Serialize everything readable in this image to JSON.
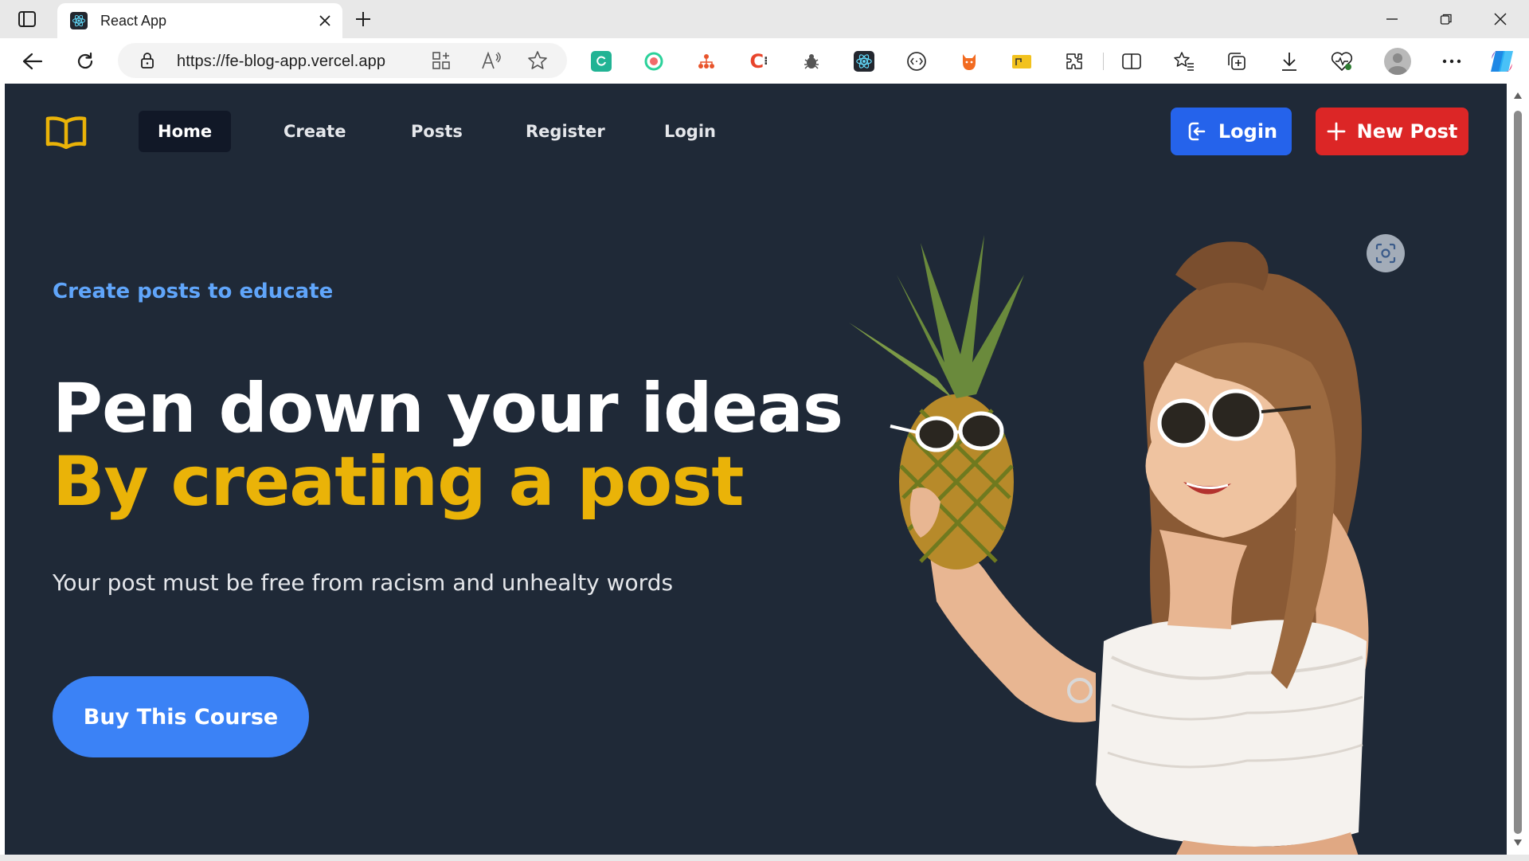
{
  "browser": {
    "tab": {
      "title": "React App",
      "favicon": "react-icon"
    },
    "address": {
      "url": "https://fe-blog-app.vercel.app"
    },
    "extensions": [
      {
        "name": "sync-extension-icon",
        "color": "#21b394"
      },
      {
        "name": "circle-extension-icon",
        "color": "#2bd19a"
      },
      {
        "name": "org-extension-icon",
        "color": "#e8542b"
      },
      {
        "name": "cplus-extension-icon",
        "color": "#e8442b"
      },
      {
        "name": "bug-extension-icon",
        "color": "#555555"
      },
      {
        "name": "react-devtools-icon",
        "color": "#23272f"
      },
      {
        "name": "code-extension-icon",
        "color": "#333333"
      },
      {
        "name": "fox-extension-icon",
        "color": "#f26b21"
      },
      {
        "name": "folder-extension-icon",
        "color": "#f2c21e"
      }
    ]
  },
  "navbar": {
    "logo": "book-icon",
    "links": [
      "Home",
      "Create",
      "Posts",
      "Register",
      "Login"
    ],
    "active_link": "Home",
    "login_button": "Login",
    "new_post_button": "New Post"
  },
  "hero": {
    "eyebrow": "Create posts to educate",
    "headline_line1": "Pen down your ideas",
    "headline_line2": "By creating a post",
    "subtitle": "Your post must be free from racism and unhealty words",
    "cta": "Buy This Course",
    "image": "woman-with-pineapple-image"
  },
  "colors": {
    "page_bg": "#1f2937",
    "accent_blue": "#2563eb",
    "accent_red": "#dc2626",
    "headline_yellow": "#eab308",
    "eyebrow_blue": "#60a5fa",
    "cta_blue": "#3b82f6"
  }
}
